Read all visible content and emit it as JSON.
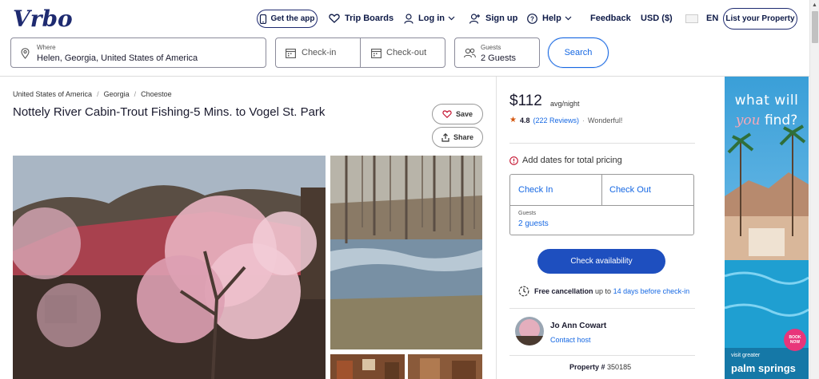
{
  "header": {
    "logo_text": "Vrbo",
    "get_app": "Get the app",
    "trip_boards": "Trip Boards",
    "log_in": "Log in",
    "sign_up": "Sign up",
    "help": "Help",
    "feedback": "Feedback",
    "currency": "USD ($)",
    "language": "EN",
    "list_property": "List your Property"
  },
  "search": {
    "where_label": "Where",
    "where_value": "Helen, Georgia, United States of America",
    "checkin_label": "Check-in",
    "checkout_label": "Check-out",
    "guests_label": "Guests",
    "guests_value": "2 Guests",
    "button": "Search"
  },
  "listing": {
    "breadcrumb": [
      "United States of America",
      "Georgia",
      "Choestoe"
    ],
    "breadcrumb_sep": "/",
    "title": "Nottely River Cabin-Trout Fishing-5 Mins. to Vogel St. Park",
    "save": "Save",
    "share": "Share"
  },
  "booking": {
    "price": "$112",
    "price_unit": "avg/night",
    "rating": "4.8",
    "reviews": "(222 Reviews)",
    "rating_desc": "Wonderful!",
    "add_dates": "Add dates for total pricing",
    "check_in": "Check In",
    "check_out": "Check Out",
    "guests_label": "Guests",
    "guests_value": "2 guests",
    "check_button": "Check availability",
    "free_cancel_bold": "Free cancellation",
    "free_cancel_text": "up to",
    "free_cancel_link": "14 days before check-in",
    "host_name": "Jo Ann Cowart",
    "contact_host": "Contact host",
    "property_label": "Property #",
    "property_number": "350185"
  },
  "ad": {
    "line1": "what will",
    "line2_italic": "you",
    "line2_rest": "find?",
    "badge": "BOOK NOW",
    "brand_small": "visit greater",
    "brand_big": "palm springs"
  },
  "colors": {
    "brand_navy": "#0e1a47",
    "link_blue": "#1668e3",
    "button_blue": "#1e4fbf",
    "star_orange": "#d4570f"
  }
}
